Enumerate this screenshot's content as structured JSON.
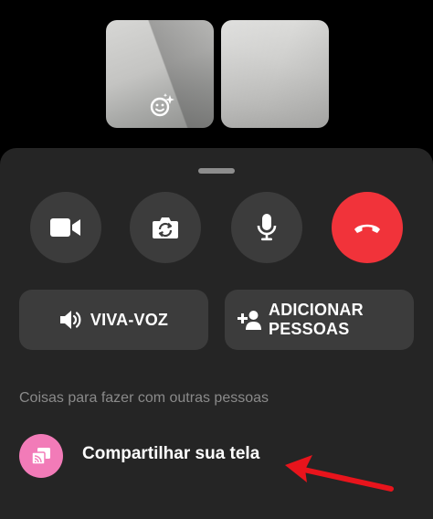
{
  "participants": [
    {
      "name": "self-video"
    },
    {
      "name": "remote-video"
    }
  ],
  "controls": {
    "video_icon": "video-camera-icon",
    "flip_icon": "camera-flip-icon",
    "mic_icon": "microphone-icon",
    "end_icon": "end-call-icon",
    "end_color": "#f1333a"
  },
  "actions": {
    "speaker_label": "VIVA-VOZ",
    "add_people_label": "ADICIONAR\nPESSOAS"
  },
  "activities": {
    "section_title": "Coisas para fazer com outras pessoas",
    "items": [
      {
        "label": "Compartilhar sua tela",
        "icon": "screen-share-icon",
        "icon_bg": "#f27bb8"
      }
    ]
  },
  "annotation": {
    "arrow_color": "#e8141c"
  }
}
